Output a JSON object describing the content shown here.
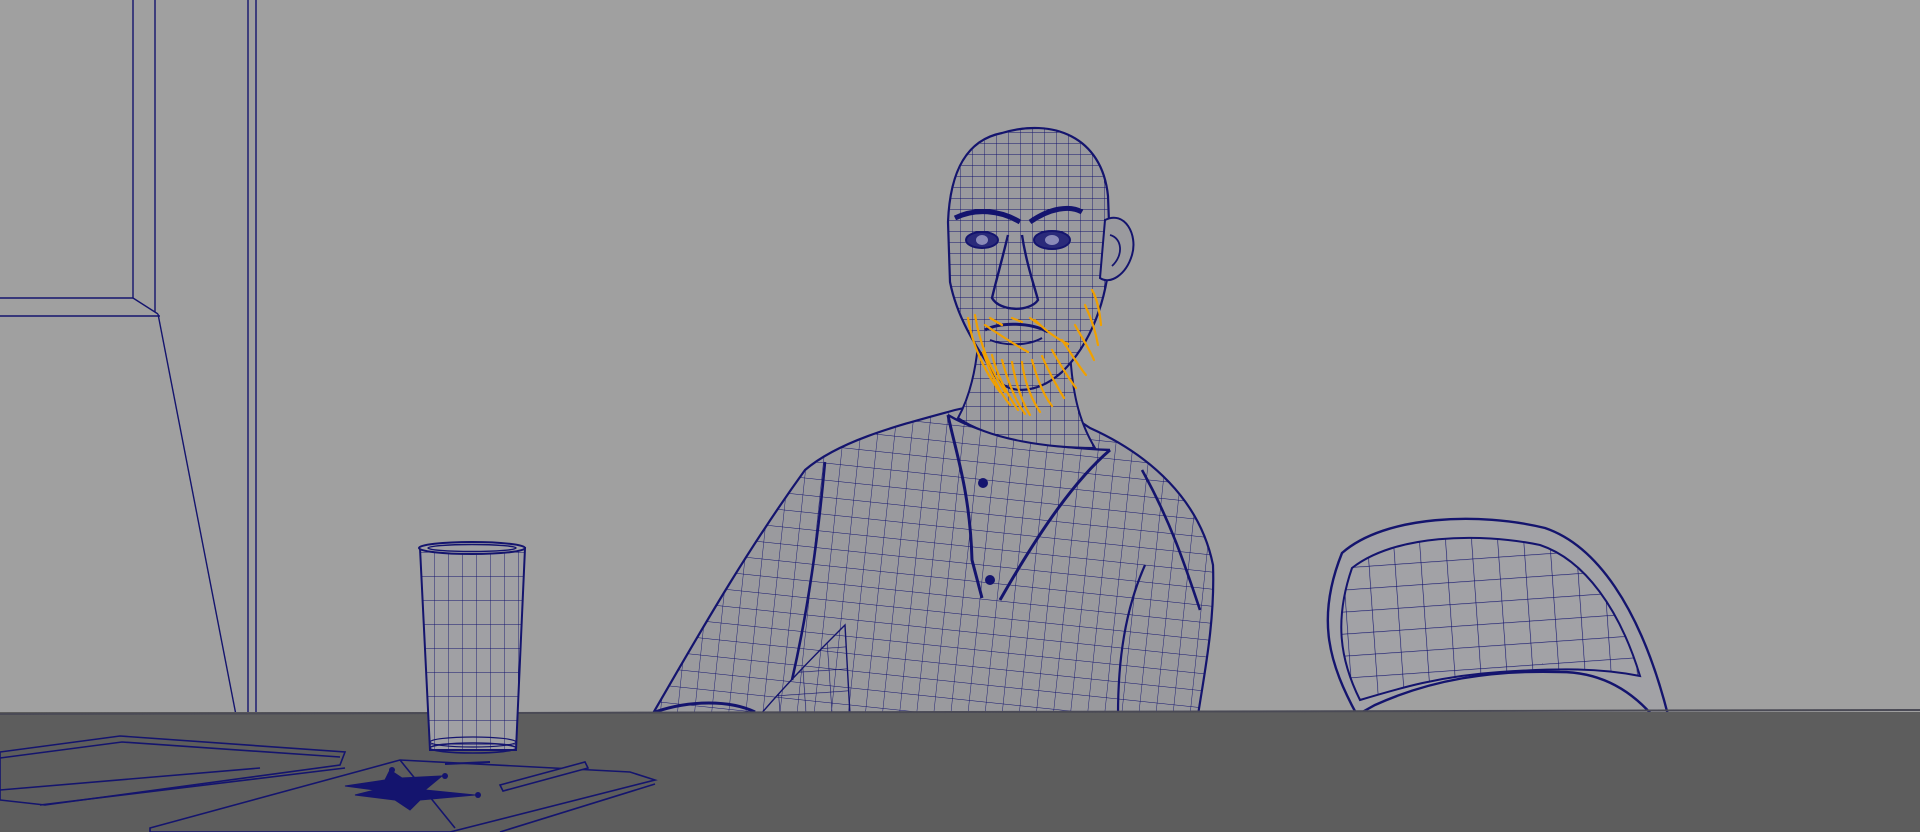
{
  "viewport": {
    "panel": "perspective-viewport",
    "display_mode": "wireframe-on-shaded",
    "camera": "shot-camera"
  },
  "scene": {
    "selected_object": "beard-curves",
    "objects": [
      "wall-door-frame",
      "character-bald-man",
      "beard-curves",
      "drinking-glass",
      "folding-chair",
      "table",
      "folder",
      "paper-sheet",
      "sheriff-badge",
      "pen"
    ]
  },
  "colors": {
    "background": "#a0a0a0",
    "table_top": "#5d5d5d",
    "wireframe": "#101066",
    "selection": "#f0a000",
    "mesh_fill": "#9a9a9e"
  }
}
